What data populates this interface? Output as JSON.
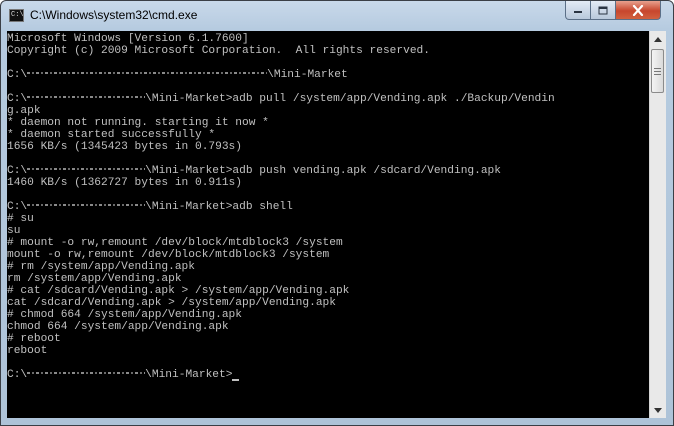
{
  "window": {
    "title": "C:\\Windows\\system32\\cmd.exe",
    "icon": "cmd-icon",
    "icon_text": "C:\\"
  },
  "controls": {
    "minimize": "minimize-icon",
    "maximize": "maximize-icon",
    "close": "close-icon"
  },
  "console": {
    "lines": [
      "Microsoft Windows [Version 6.1.7600]",
      "Copyright (c) 2009 Microsoft Corporation.  All rights reserved.",
      "",
      "C:\\ [redacted] \\Mini-Market",
      "",
      "C:\\ [redacted] \\Mini-Market>adb pull /system/app/Vending.apk ./Backup/Vendin",
      "g.apk",
      "* daemon not running. starting it now *",
      "* daemon started successfully *",
      "1656 KB/s (1345423 bytes in 0.793s)",
      "",
      "C:\\ [redacted] \\Mini-Market>adb push vending.apk /sdcard/Vending.apk",
      "1460 KB/s (1362727 bytes in 0.911s)",
      "",
      "C:\\ [redacted] \\Mini-Market>adb shell",
      "# su",
      "su",
      "# mount -o rw,remount /dev/block/mtdblock3 /system",
      "mount -o rw,remount /dev/block/mtdblock3 /system",
      "# rm /system/app/Vending.apk",
      "rm /system/app/Vending.apk",
      "# cat /sdcard/Vending.apk > /system/app/Vending.apk",
      "cat /sdcard/Vending.apk > /system/app/Vending.apk",
      "# chmod 664 /system/app/Vending.apk",
      "chmod 664 /system/app/Vending.apk",
      "# reboot",
      "reboot",
      "",
      "C:\\ [redacted] \\Mini-Market>"
    ]
  },
  "colors": {
    "console_bg": "#000000",
    "console_text": "#c0c0c0",
    "close_button": "#c7462d"
  }
}
